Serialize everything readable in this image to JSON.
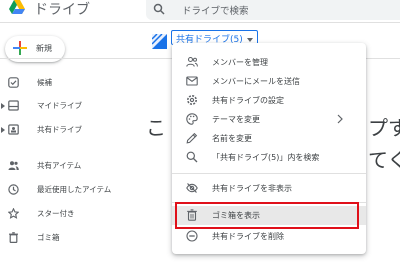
{
  "header": {
    "app_title": "ドライブ",
    "search_placeholder": "ドライブで検索"
  },
  "sidebar": {
    "new_label": "新規",
    "items": [
      {
        "label": "候補",
        "icon": "check-circle-icon"
      },
      {
        "label": "マイドライブ",
        "icon": "my-drive-icon"
      },
      {
        "label": "共有ドライブ",
        "icon": "shared-drives-icon"
      },
      {
        "label": "共有アイテム",
        "icon": "people-icon"
      },
      {
        "label": "最近使用したアイテム",
        "icon": "clock-icon"
      },
      {
        "label": "スター付き",
        "icon": "star-icon"
      },
      {
        "label": "ゴミ箱",
        "icon": "trash-icon"
      }
    ]
  },
  "main": {
    "shared_drive_chip": "共有ドライブ(5)",
    "bg_line1_start": "こ",
    "bg_line1_end": "プす",
    "bg_line2_end": "てく"
  },
  "menu": {
    "items": [
      {
        "label": "メンバーを管理",
        "icon": "manage-members-icon"
      },
      {
        "label": "メンバーにメールを送信",
        "icon": "email-icon"
      },
      {
        "label": "共有ドライブの設定",
        "icon": "settings-icon"
      },
      {
        "label": "テーマを変更",
        "icon": "palette-icon"
      },
      {
        "label": "名前を変更",
        "icon": "pencil-icon"
      },
      {
        "label": "「共有ドライブ(5)」内を検索",
        "icon": "search-icon"
      },
      {
        "label": "共有ドライブを非表示",
        "icon": "eye-off-icon"
      },
      {
        "label": "ゴミ箱を表示",
        "icon": "trash-icon"
      },
      {
        "label": "共有ドライブを削除",
        "icon": "remove-circle-icon"
      }
    ],
    "highlighted_item": "ゴミ箱を表示",
    "highlight_color": "#e0101a"
  },
  "colors": {
    "accent": "#1a73e8",
    "text": "#3c4043"
  }
}
